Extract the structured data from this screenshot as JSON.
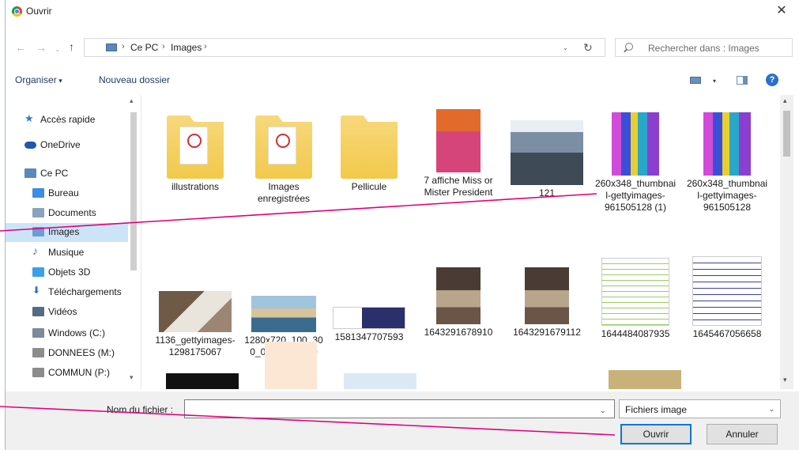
{
  "window": {
    "title": "Ouvrir",
    "close_glyph": "✕"
  },
  "address": {
    "back_glyph": "←",
    "forward_glyph": "→",
    "recent_glyph": "⌄",
    "up_glyph": "↑",
    "crumbs": [
      "Ce PC",
      "Images"
    ],
    "sep_glyph": "›",
    "dropdown_glyph": "⌄",
    "refresh_glyph": "↻"
  },
  "search": {
    "placeholder": "Rechercher dans : Images"
  },
  "toolbar": {
    "organize_label": "Organiser",
    "new_folder_label": "Nouveau dossier",
    "help_glyph": "?"
  },
  "nav": {
    "items": [
      {
        "label": "Accès rapide",
        "icon": "star-icon",
        "color": "#2e7bd6"
      },
      {
        "label": "OneDrive",
        "icon": "cloud-icon",
        "color": "#1e5aa8"
      },
      {
        "label": "Ce PC",
        "icon": "computer-icon",
        "color": "#5b88b8"
      },
      {
        "label": "Bureau",
        "icon": "desktop-icon",
        "color": "#3a8ee6"
      },
      {
        "label": "Documents",
        "icon": "document-icon",
        "color": "#8aa3bf"
      },
      {
        "label": "Images",
        "icon": "pictures-icon",
        "color": "#6b9ed6"
      },
      {
        "label": "Musique",
        "icon": "music-icon",
        "color": "#4a6fa5"
      },
      {
        "label": "Objets 3D",
        "icon": "cube-icon",
        "color": "#3aa0e8"
      },
      {
        "label": "Téléchargements",
        "icon": "download-icon",
        "color": "#2b70c9"
      },
      {
        "label": "Vidéos",
        "icon": "video-icon",
        "color": "#556b85"
      },
      {
        "label": "Windows  (C:)",
        "icon": "drive-icon",
        "color": "#7c8a99"
      },
      {
        "label": "DONNEES (M:)",
        "icon": "network-drive-icon",
        "color": "#8c8c8c"
      },
      {
        "label": "COMMUN (P:)",
        "icon": "network-drive-icon",
        "color": "#8c8c8c"
      }
    ],
    "selected_index": 5
  },
  "files": [
    {
      "name": "illustrations",
      "kind": "folder-pdf"
    },
    {
      "name": "Images enregistrées",
      "kind": "folder-pdf"
    },
    {
      "name": "Pellicule",
      "kind": "folder"
    },
    {
      "name": "7 affiche Miss or Mister President",
      "kind": "poster"
    },
    {
      "name": "121",
      "kind": "photo-room"
    },
    {
      "name": "260x348_thumbnail-gettyimages-961505128 (1)",
      "kind": "silhouettes"
    },
    {
      "name": "260x348_thumbnail-gettyimages-961505128",
      "kind": "silhouettes"
    },
    {
      "name": "1136_gettyimages-1298175067",
      "kind": "photo-child"
    },
    {
      "name": "1280x720_100_300_000000x30x0",
      "kind": "photo-harbor"
    },
    {
      "name": "1581347707593",
      "kind": "banner"
    },
    {
      "name": "1643291678910",
      "kind": "photo-conference"
    },
    {
      "name": "1643291679112",
      "kind": "photo-hall"
    },
    {
      "name": "1644484087935",
      "kind": "doc-green"
    },
    {
      "name": "1645467056658",
      "kind": "doc-press"
    }
  ],
  "bottom": {
    "filename_label": "Nom du fichier :",
    "filename_value": "",
    "filetype_value": "Fichiers image",
    "dropdown_glyph": "⌄",
    "open_label": "Ouvrir",
    "cancel_label": "Annuler"
  },
  "colors": {
    "accent": "#0078d7",
    "callout": "#e0007a",
    "nav_selected": "#cce4f7"
  }
}
